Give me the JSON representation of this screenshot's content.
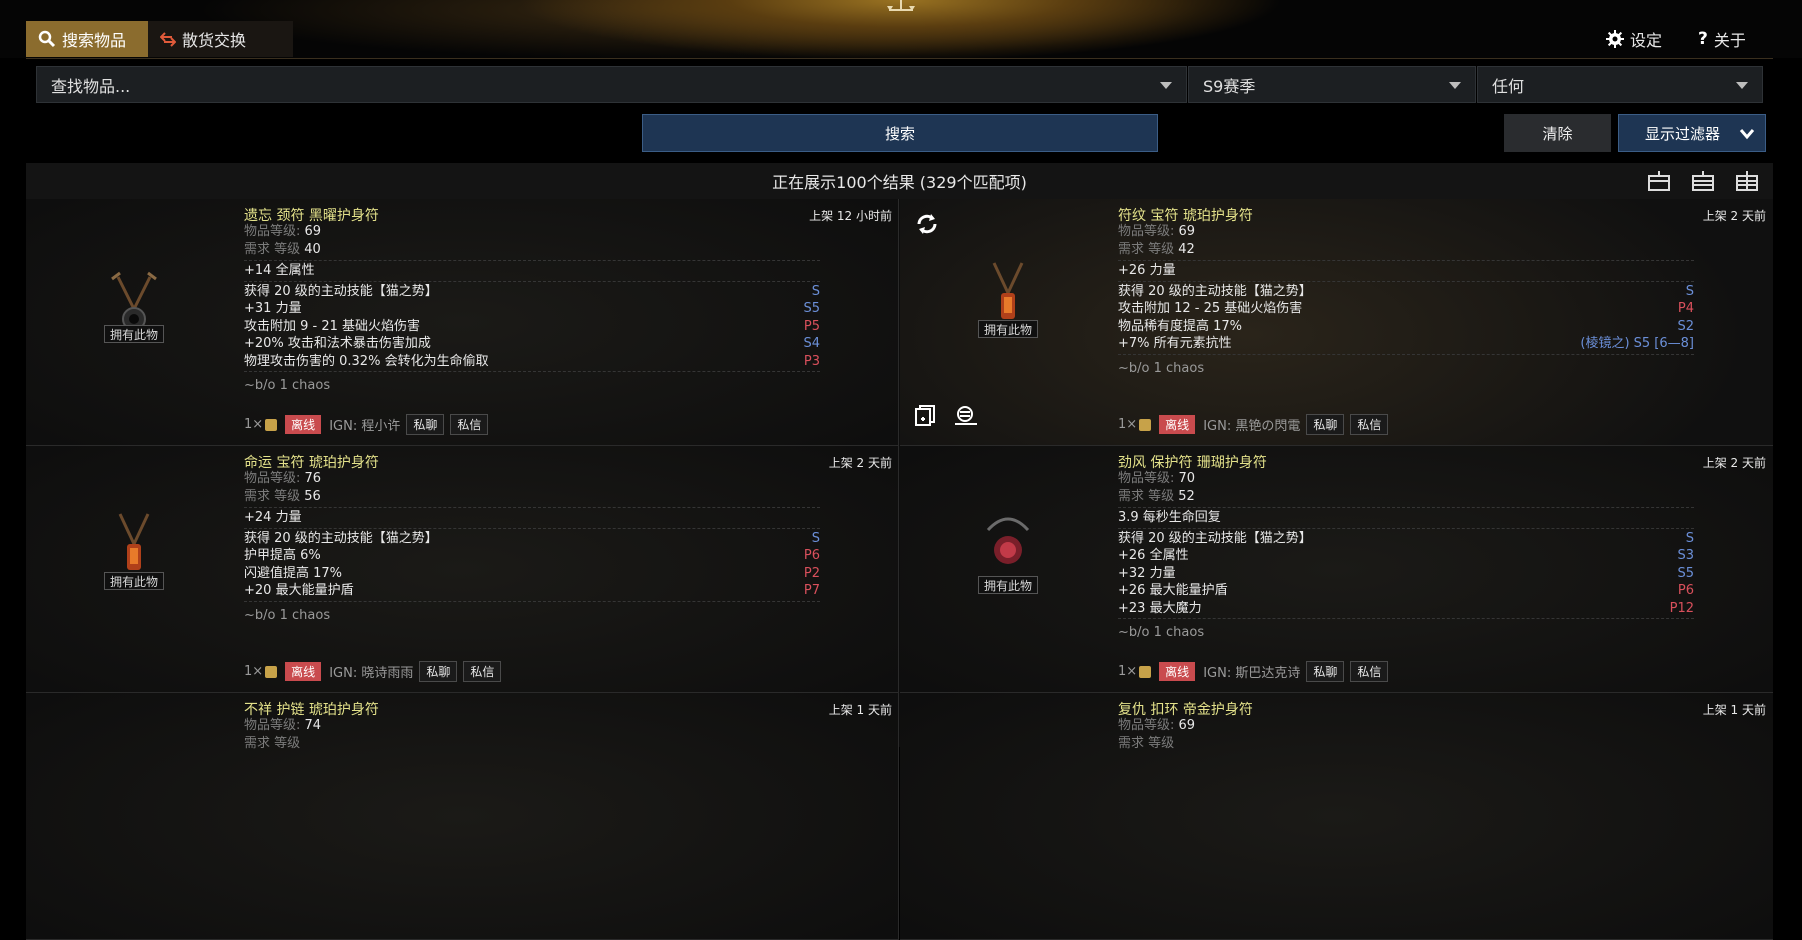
{
  "header": {
    "tab_search": "搜索物品",
    "tab_bulk": "散货交换",
    "settings": "设定",
    "about": "关于"
  },
  "search": {
    "item_placeholder": "查找物品...",
    "league": "S9赛季",
    "status": "任何",
    "search_button": "搜索",
    "clear_button": "清除",
    "filter_button": "显示过滤器"
  },
  "results": {
    "summary": "正在展示100个结果 (329个匹配项)"
  },
  "labels": {
    "own": "拥有此物",
    "item_level": "物品等级: ",
    "req_level": "需求 等级 ",
    "offline": "离线",
    "whisper": "私聊",
    "message": "私信",
    "qty": "1×"
  },
  "items": [
    {
      "name": "遗忘 颈符 黑曜护身符",
      "listed": "上架 12 小时前",
      "ilvl": "69",
      "req": "40",
      "implicit": "+14 全属性",
      "mods": [
        {
          "text": "获得 20 级的主动技能【猫之势】",
          "tier": "S",
          "type": "S"
        },
        {
          "text": "+31 力量",
          "tier": "S5",
          "type": "S"
        },
        {
          "text": "攻击附加 9 - 21 基础火焰伤害",
          "tier": "P5",
          "type": "P"
        },
        {
          "text": "+20% 攻击和法术暴击伤害加成",
          "tier": "S4",
          "type": "S"
        },
        {
          "text": "物理攻击伤害的 0.32% 会转化为生命偷取",
          "tier": "P3",
          "type": "P"
        }
      ],
      "price": "~b/o 1 chaos",
      "ign": "IGN: 程小许"
    },
    {
      "name": "符纹 宝符 琥珀护身符",
      "listed": "上架 2 天前",
      "ilvl": "69",
      "req": "42",
      "implicit": "+26 力量",
      "mods": [
        {
          "text": "获得 20 级的主动技能【猫之势】",
          "tier": "S",
          "type": "S"
        },
        {
          "text": "攻击附加 12 - 25 基础火焰伤害",
          "tier": "P4",
          "type": "P"
        },
        {
          "text": "物品稀有度提高 17%",
          "tier": "S2",
          "type": "S"
        },
        {
          "text": "+7% 所有元素抗性",
          "tier": "(棱镜之) S5 [6—8]",
          "type": "S"
        }
      ],
      "price": "~b/o 1 chaos",
      "ign": "IGN: 黒铯の閃電"
    },
    {
      "name": "命运 宝符 琥珀护身符",
      "listed": "上架 2 天前",
      "ilvl": "76",
      "req": "56",
      "implicit": "+24 力量",
      "mods": [
        {
          "text": "获得 20 级的主动技能【猫之势】",
          "tier": "S",
          "type": "S"
        },
        {
          "text": "护甲提高 6%",
          "tier": "P6",
          "type": "P"
        },
        {
          "text": "闪避值提高 17%",
          "tier": "P2",
          "type": "P"
        },
        {
          "text": "+20 最大能量护盾",
          "tier": "P7",
          "type": "P"
        }
      ],
      "price": "~b/o 1 chaos",
      "ign": "IGN: 晓诗雨雨"
    },
    {
      "name": "劲风 保护符 珊瑚护身符",
      "listed": "上架 2 天前",
      "ilvl": "70",
      "req": "52",
      "implicit": "3.9 每秒生命回复",
      "mods": [
        {
          "text": "获得 20 级的主动技能【猫之势】",
          "tier": "S",
          "type": "S"
        },
        {
          "text": "+26 全属性",
          "tier": "S3",
          "type": "S"
        },
        {
          "text": "+32 力量",
          "tier": "S5",
          "type": "S"
        },
        {
          "text": "+26 最大能量护盾",
          "tier": "P6",
          "type": "P"
        },
        {
          "text": "+23 最大魔力",
          "tier": "P12",
          "type": "P"
        }
      ],
      "price": "~b/o 1 chaos",
      "ign": "IGN: 斯巴达克诗"
    },
    {
      "name": "不祥 护链 琥珀护身符",
      "listed": "上架 1 天前",
      "ilvl": "74",
      "req": "",
      "implicit": "",
      "mods": [],
      "price": "",
      "ign": ""
    },
    {
      "name": "复仇 扣环 帝金护身符",
      "listed": "上架 1 天前",
      "ilvl": "69",
      "req": "",
      "implicit": "",
      "mods": [],
      "price": "",
      "ign": ""
    }
  ],
  "colors": {
    "accent_gold": "#8b6c2e",
    "button_blue": "#1e3553",
    "item_name": "#e3e18a",
    "suffix": "#6b8fd8",
    "prefix": "#d9505c",
    "offline": "#c94b4e"
  },
  "icons": [
    "search-icon",
    "swap-icon",
    "gear-icon",
    "help-icon",
    "scales-icon",
    "refresh-icon",
    "copy-icon",
    "find-similar-icon",
    "chevron-down-icon",
    "view-icons"
  ]
}
